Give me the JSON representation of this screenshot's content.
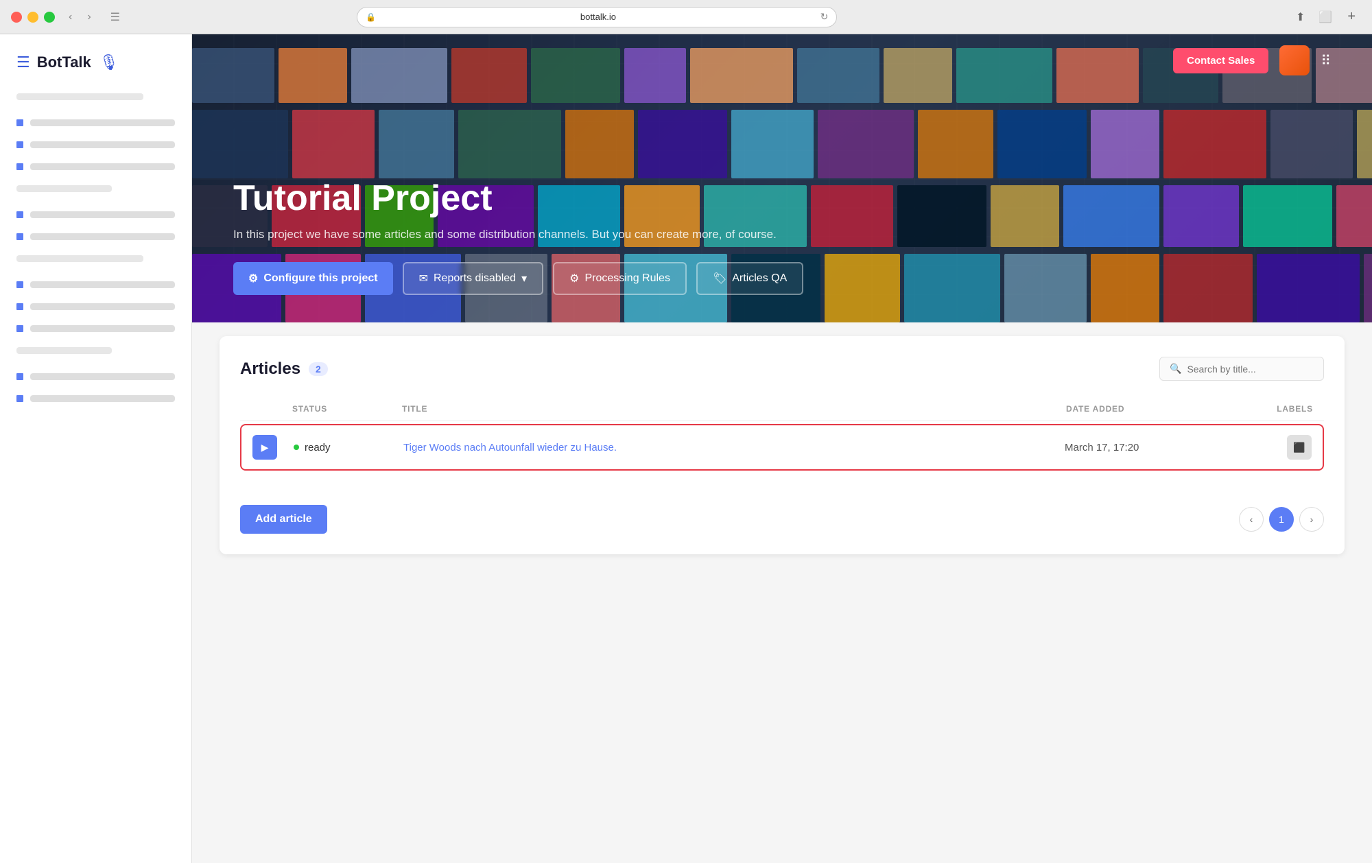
{
  "browser": {
    "url": "bottalk.io",
    "lock_icon": "🔒",
    "reload_icon": "↻",
    "bookmark_icon": "★"
  },
  "sidebar": {
    "logo_brand": "BotTalk",
    "items": []
  },
  "header": {
    "contact_sales_label": "Contact Sales"
  },
  "hero": {
    "title": "Tutorial Project",
    "description": "In this project we have some articles and some distribution channels. But you can create more, of course.",
    "configure_btn": "Configure this project",
    "reports_btn": "Reports disabled",
    "processing_btn": "Processing Rules",
    "articles_qa_btn": "Articles QA"
  },
  "articles": {
    "title": "Articles",
    "count": "2",
    "search_placeholder": "Search by title...",
    "columns": {
      "status": "STATUS",
      "title": "TITLE",
      "date_added": "DATE ADDED",
      "labels": "LABELS"
    },
    "rows": [
      {
        "status": "ready",
        "title": "Tiger Woods nach Autounfall wieder zu   Hause.",
        "date": "March 17, 17:20",
        "labels": "⬛"
      }
    ],
    "add_article_label": "Add article",
    "pagination": {
      "prev": "‹",
      "current": "1",
      "next": "›"
    }
  },
  "icons": {
    "configure": "⚙",
    "reports": "✉",
    "processing": "⚙",
    "articles_qa": "🏷",
    "play": "▶",
    "search": "🔍",
    "grid": "⋮⋮⋮",
    "settings": "⚙",
    "sidebar_toggle": "☰",
    "nav_back": "‹",
    "nav_forward": "›"
  },
  "colors": {
    "accent": "#5b7df5",
    "danger": "#e63946",
    "success": "#27c93f",
    "sales_btn": "#ff4d6d",
    "avatar": "#e8520a"
  }
}
